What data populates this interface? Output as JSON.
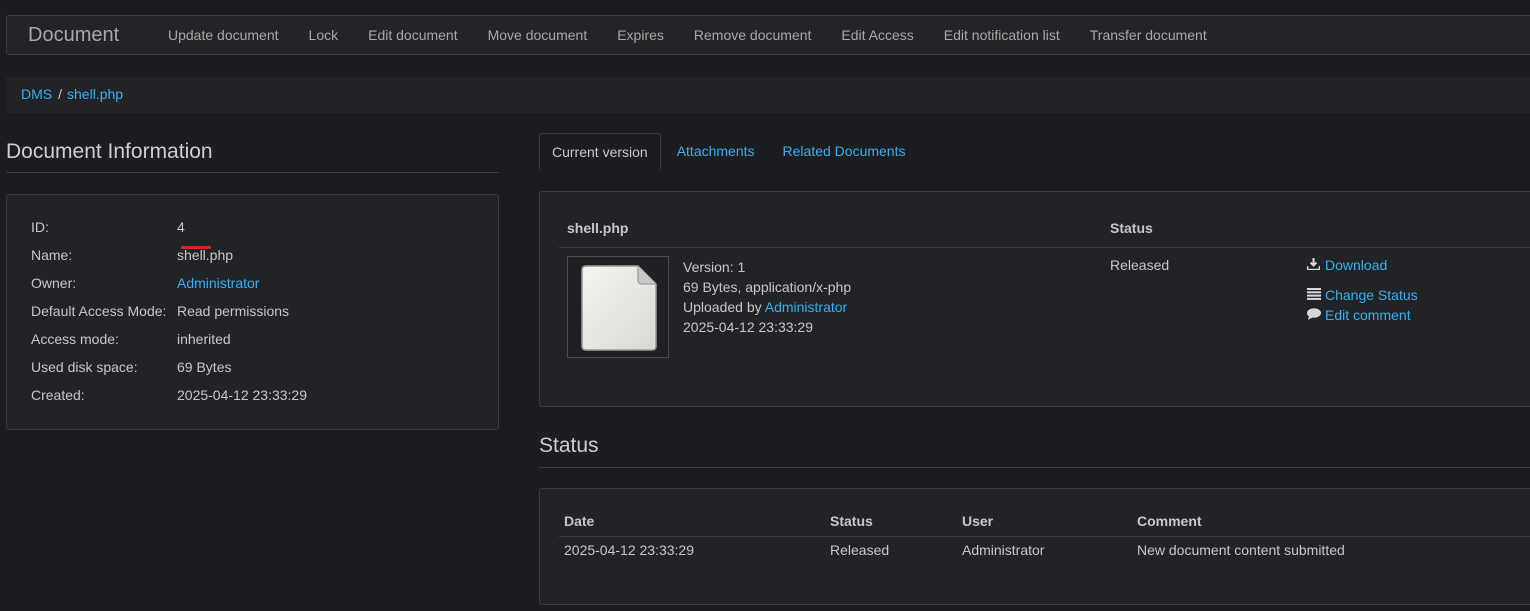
{
  "navbar": {
    "brand": "Document",
    "items": [
      "Update document",
      "Lock",
      "Edit document",
      "Move document",
      "Expires",
      "Remove document",
      "Edit Access",
      "Edit notification list",
      "Transfer document"
    ]
  },
  "breadcrumb": {
    "root": "DMS",
    "separator": "/",
    "current": "shell.php"
  },
  "document_info": {
    "title": "Document Information",
    "rows": [
      {
        "label": "ID:",
        "value": "4"
      },
      {
        "label": "Name:",
        "value": "shell.php"
      },
      {
        "label": "Owner:",
        "value": "Administrator"
      },
      {
        "label": "Default Access Mode:",
        "value": "Read permissions"
      },
      {
        "label": "Access mode:",
        "value": "inherited"
      },
      {
        "label": "Used disk space:",
        "value": "69 Bytes"
      },
      {
        "label": "Created:",
        "value": "2025-04-12 23:33:29"
      }
    ]
  },
  "tabs": [
    "Current version",
    "Attachments",
    "Related Documents"
  ],
  "current_version": {
    "header_name": "shell.php",
    "header_status": "Status",
    "version_line": "Version: 1",
    "size_line": "69 Bytes, application/x-php",
    "uploaded_by_prefix": "Uploaded by",
    "uploaded_by_user": "Administrator",
    "date": "2025-04-12 23:33:29",
    "status": "Released",
    "actions": {
      "download": "Download",
      "change_status": "Change Status",
      "edit_comment": "Edit comment"
    }
  },
  "status_section": {
    "title": "Status",
    "columns": [
      "Date",
      "Status",
      "User",
      "Comment"
    ],
    "rows": [
      [
        "2025-04-12 23:33:29",
        "Released",
        "Administrator",
        "New document content submitted"
      ]
    ]
  },
  "colors": {
    "background": "#1b1d20",
    "panel": "#212327",
    "link": "#3ab0f0",
    "annotation": "#d9261c"
  }
}
